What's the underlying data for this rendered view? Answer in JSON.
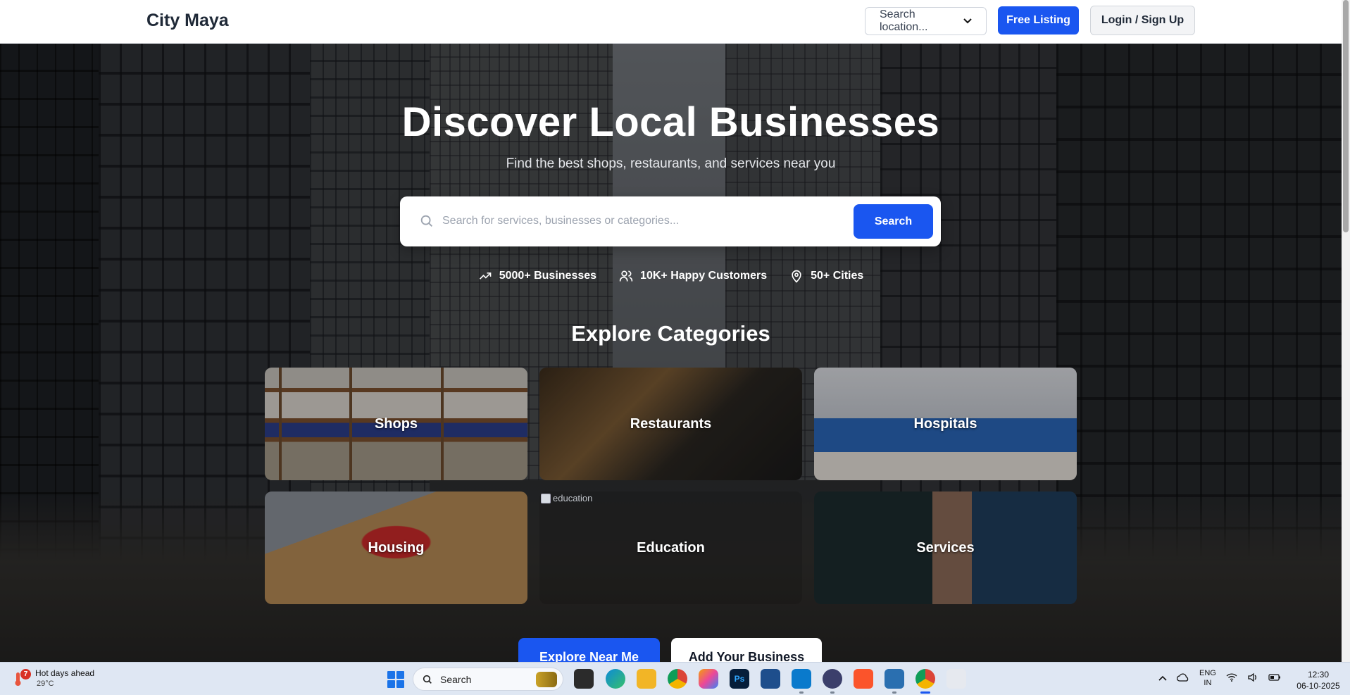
{
  "navbar": {
    "brand": "City Maya",
    "location_placeholder": "Search location...",
    "free_listing": "Free Listing",
    "login": "Login / Sign Up"
  },
  "hero": {
    "title": "Discover Local Businesses",
    "subtitle": "Find the best shops, restaurants, and services near you",
    "search_placeholder": "Search for services, businesses or categories...",
    "search_button": "Search"
  },
  "stats": [
    {
      "icon": "trending-up-icon",
      "label": "5000+ Businesses"
    },
    {
      "icon": "users-icon",
      "label": "10K+ Happy Customers"
    },
    {
      "icon": "map-pin-icon",
      "label": "50+ Cities"
    }
  ],
  "categories": {
    "title": "Explore Categories",
    "items": [
      {
        "label": "Shops"
      },
      {
        "label": "Restaurants"
      },
      {
        "label": "Hospitals"
      },
      {
        "label": "Housing"
      },
      {
        "label": "Education",
        "broken_alt": "education"
      },
      {
        "label": "Services"
      }
    ]
  },
  "cta": {
    "primary": "Explore Near Me",
    "secondary": "Add Your Business"
  },
  "taskbar": {
    "weather_alert_count": "7",
    "weather_text": "Hot days ahead",
    "weather_temp": "29°C",
    "search_label": "Search",
    "tray_lang_top": "ENG",
    "tray_lang_bottom": "IN",
    "time": "12:30",
    "date": "06-10-2025",
    "apps": [
      "task-view",
      "edge",
      "file-explorer",
      "chrome",
      "copilot",
      "photoshop",
      "terminal",
      "vscode",
      "app",
      "brave",
      "app2",
      "chrome-active",
      "snipping-tool"
    ]
  },
  "colors": {
    "primary": "#1a56f0",
    "navbar_bg": "#ffffff",
    "taskbar_bg": "#dfe7f3"
  }
}
